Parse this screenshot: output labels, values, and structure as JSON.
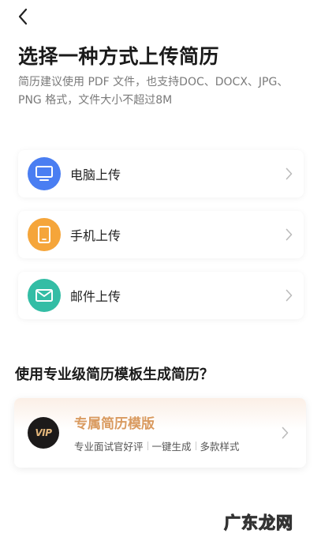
{
  "header": {
    "title": "选择一种方式上传简历",
    "subtitle": "简历建议使用 PDF 文件，也支持DOC、DOCX、JPG、PNG 格式，文件大小不超过8M"
  },
  "upload_options": [
    {
      "label": "电脑上传",
      "icon": "monitor-icon",
      "color": "#4a7ef2"
    },
    {
      "label": "手机上传",
      "icon": "phone-icon",
      "color": "#f5a53a"
    },
    {
      "label": "邮件上传",
      "icon": "mail-icon",
      "color": "#33bda5"
    }
  ],
  "template_section": {
    "heading": "使用专业级简历模板生成简历？",
    "card": {
      "logo_text": "VIP",
      "title": "专属简历模版",
      "features": [
        "专业面试官好评",
        "一键生成",
        "多款样式"
      ]
    }
  },
  "watermark": "广东龙网"
}
